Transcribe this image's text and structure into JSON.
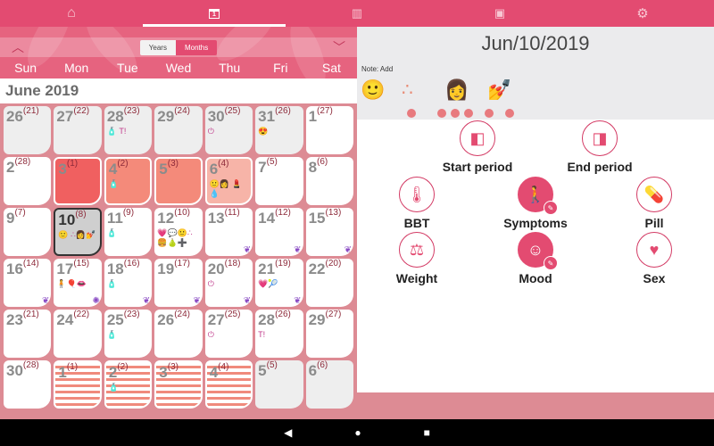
{
  "topbar": {
    "tabs": [
      {
        "icon": "home-icon",
        "glyph": "⌂",
        "active": false
      },
      {
        "icon": "calendar-icon",
        "glyph": "1",
        "active": true
      },
      {
        "icon": "chart-icon",
        "glyph": "▥",
        "active": false
      },
      {
        "icon": "book-icon",
        "glyph": "▣",
        "active": false
      },
      {
        "icon": "gear-icon",
        "glyph": "⚙",
        "active": false
      }
    ]
  },
  "calendar": {
    "prev_glyph": "︿",
    "next_glyph": "﹀",
    "toggle": {
      "years": "Years",
      "months": "Months",
      "selected": "Months"
    },
    "weekdays": [
      "Sun",
      "Mon",
      "Tue",
      "Wed",
      "Thu",
      "Fri",
      "Sat"
    ],
    "month_title": "June 2019",
    "days": [
      {
        "d": "26",
        "c": "(21)",
        "type": "other",
        "marks": ""
      },
      {
        "d": "27",
        "c": "(22)",
        "type": "other",
        "marks": ""
      },
      {
        "d": "28",
        "c": "(23)",
        "type": "other",
        "marks": "🧴 T!"
      },
      {
        "d": "29",
        "c": "(24)",
        "type": "other",
        "marks": ""
      },
      {
        "d": "30",
        "c": "(25)",
        "type": "other",
        "marks": "⏻"
      },
      {
        "d": "31",
        "c": "(26)",
        "type": "other",
        "marks": "😍"
      },
      {
        "d": "1",
        "c": "(27)",
        "type": "",
        "marks": ""
      },
      {
        "d": "2",
        "c": "(28)",
        "type": "",
        "marks": ""
      },
      {
        "d": "3",
        "c": "(1)",
        "type": "p1",
        "marks": ""
      },
      {
        "d": "4",
        "c": "(2)",
        "type": "p2",
        "marks": "🧴"
      },
      {
        "d": "5",
        "c": "(3)",
        "type": "p3",
        "marks": ""
      },
      {
        "d": "6",
        "c": "(4)",
        "type": "p4",
        "marks": "🙂👩 💄💧"
      },
      {
        "d": "7",
        "c": "(5)",
        "type": "",
        "marks": ""
      },
      {
        "d": "8",
        "c": "(6)",
        "type": "",
        "marks": ""
      },
      {
        "d": "9",
        "c": "(7)",
        "type": "",
        "marks": ""
      },
      {
        "d": "10",
        "c": "(8)",
        "type": "selected",
        "marks": "🙂 ∴👩💅"
      },
      {
        "d": "11",
        "c": "(9)",
        "type": "",
        "marks": "🧴"
      },
      {
        "d": "12",
        "c": "(10)",
        "type": "",
        "marks": "💗💬🙂∴ 🍔🍐➕"
      },
      {
        "d": "13",
        "c": "(11)",
        "type": "",
        "marks": "",
        "leaf": true
      },
      {
        "d": "14",
        "c": "(12)",
        "type": "",
        "marks": "",
        "leaf": true
      },
      {
        "d": "15",
        "c": "(13)",
        "type": "",
        "marks": "",
        "leaf": true
      },
      {
        "d": "16",
        "c": "(14)",
        "type": "",
        "marks": "",
        "leaf": true
      },
      {
        "d": "17",
        "c": "(15)",
        "type": "",
        "marks": "🧍🎈👄",
        "flower": true
      },
      {
        "d": "18",
        "c": "(16)",
        "type": "",
        "marks": "🧴",
        "leaf": true
      },
      {
        "d": "19",
        "c": "(17)",
        "type": "",
        "marks": "",
        "leaf": true
      },
      {
        "d": "20",
        "c": "(18)",
        "type": "",
        "marks": "⏻",
        "leaf": true
      },
      {
        "d": "21",
        "c": "(19)",
        "type": "",
        "marks": "💗🎾",
        "leaf": true
      },
      {
        "d": "22",
        "c": "(20)",
        "type": "",
        "marks": ""
      },
      {
        "d": "23",
        "c": "(21)",
        "type": "",
        "marks": ""
      },
      {
        "d": "24",
        "c": "(22)",
        "type": "",
        "marks": ""
      },
      {
        "d": "25",
        "c": "(23)",
        "type": "",
        "marks": "🧴"
      },
      {
        "d": "26",
        "c": "(24)",
        "type": "",
        "marks": ""
      },
      {
        "d": "27",
        "c": "(25)",
        "type": "",
        "marks": "⏻"
      },
      {
        "d": "28",
        "c": "(26)",
        "type": "",
        "marks": "T!"
      },
      {
        "d": "29",
        "c": "(27)",
        "type": "",
        "marks": ""
      },
      {
        "d": "30",
        "c": "(28)",
        "type": "",
        "marks": ""
      },
      {
        "d": "1",
        "c": "(1)",
        "type": "pred",
        "marks": ""
      },
      {
        "d": "2",
        "c": "(2)",
        "type": "pred",
        "marks": "🧴"
      },
      {
        "d": "3",
        "c": "(3)",
        "type": "pred",
        "marks": ""
      },
      {
        "d": "4",
        "c": "(4)",
        "type": "pred",
        "marks": ""
      },
      {
        "d": "5",
        "c": "(5)",
        "type": "other",
        "marks": ""
      },
      {
        "d": "6",
        "c": "(6)",
        "type": "other",
        "marks": ""
      }
    ]
  },
  "detail": {
    "date": "Jun/10/2019",
    "note": "Note: Add",
    "logged": [
      "🙂",
      "∴",
      "👩",
      "💅"
    ],
    "actions": [
      {
        "label": "Start period",
        "glyph": "◧",
        "filled": false
      },
      {
        "label": "End period",
        "glyph": "◨",
        "filled": false
      },
      {
        "label": "BBT",
        "glyph": "🌡",
        "filled": false
      },
      {
        "label": "Symptoms",
        "glyph": "🚶",
        "filled": true
      },
      {
        "label": "Pill",
        "glyph": "💊",
        "filled": false
      },
      {
        "label": "Weight",
        "glyph": "⚖",
        "filled": false
      },
      {
        "label": "Mood",
        "glyph": "☺",
        "filled": true
      },
      {
        "label": "Sex",
        "glyph": "♥",
        "filled": false
      }
    ],
    "edit_glyph": "✎"
  },
  "system_nav": {
    "back": "◀",
    "home": "●",
    "recents": "■"
  }
}
